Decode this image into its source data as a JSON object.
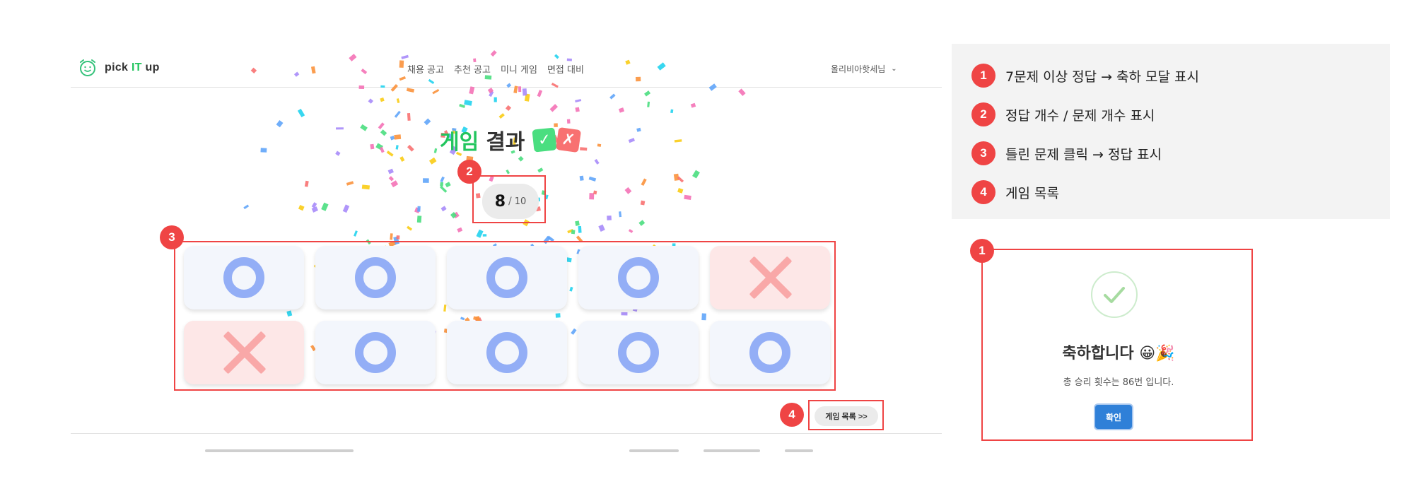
{
  "header": {
    "logo_text_pre": "pick ",
    "logo_text_it": "IT",
    "logo_text_post": " up",
    "nav": [
      "채용 공고",
      "추천 공고",
      "미니 게임",
      "면접 대비"
    ],
    "user_name": "올리비아핫세님"
  },
  "result": {
    "title_highlight": "게임",
    "title_rest": "결과",
    "title_icon_check": "✓",
    "title_icon_x": "✗",
    "score": "8",
    "score_separator": "/",
    "total": "10",
    "answers": [
      "O",
      "O",
      "O",
      "O",
      "X",
      "X",
      "O",
      "O",
      "O",
      "O"
    ]
  },
  "game_list_button": "게임 목록 >>",
  "annotations": {
    "badges": [
      "1",
      "2",
      "3",
      "4"
    ],
    "legend": [
      {
        "num": "1",
        "text": "7문제 이상 정답 → 축하 모달 표시"
      },
      {
        "num": "2",
        "text": "정답 개수 / 문제 개수 표시"
      },
      {
        "num": "3",
        "text": "틀린 문제 클릭 → 정답 표시"
      },
      {
        "num": "4",
        "text": "게임 목록"
      }
    ]
  },
  "modal": {
    "badge": "1",
    "title": "축하합니다 😀🎉",
    "subtitle": "총 승리 횟수는 86번 입니다.",
    "confirm": "확인"
  },
  "colors": {
    "accent_green": "#22c55e",
    "annotation_red": "#ef4444",
    "o_mark": "#93aef6",
    "x_mark": "#f9a8a8",
    "confirm_blue": "#2f80d8"
  }
}
